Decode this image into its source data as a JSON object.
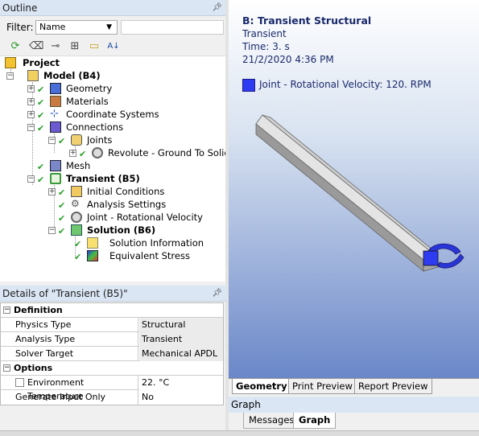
{
  "outline": {
    "title": "Outline",
    "pin": "ᵖ",
    "filter_label": "Filter:",
    "filter_value": "Name",
    "tree": [
      {
        "label": "Project"
      },
      {
        "label": "Model (B4)"
      },
      {
        "label": "Geometry"
      },
      {
        "label": "Materials"
      },
      {
        "label": "Coordinate Systems"
      },
      {
        "label": "Connections"
      },
      {
        "label": "Joints"
      },
      {
        "label": "Revolute - Ground To Solid"
      },
      {
        "label": "Mesh"
      },
      {
        "label": "Transient (B5)"
      },
      {
        "label": "Initial Conditions"
      },
      {
        "label": "Analysis Settings"
      },
      {
        "label": "Joint - Rotational Velocity"
      },
      {
        "label": "Solution (B6)"
      },
      {
        "label": "Solution Information"
      },
      {
        "label": "Equivalent Stress"
      }
    ]
  },
  "details": {
    "title": "Details of \"Transient (B5)\"",
    "sections": [
      {
        "name": "Definition",
        "rows": [
          {
            "k": "Physics Type",
            "v": "Structural"
          },
          {
            "k": "Analysis Type",
            "v": "Transient"
          },
          {
            "k": "Solver Target",
            "v": "Mechanical APDL"
          }
        ]
      },
      {
        "name": "Options",
        "rows": [
          {
            "k": "Environment Temperature",
            "v": "22. °C"
          },
          {
            "k": "Generate Input Only",
            "v": "No"
          }
        ]
      }
    ]
  },
  "viewport": {
    "title": "B: Transient Structural",
    "lines": [
      "Transient",
      "Time: 3. s",
      "21/2/2020 4:36 PM"
    ],
    "legend": "Joint - Rotational Velocity: 120. RPM",
    "legend_color": "#2f3bf0",
    "tabs": [
      "Geometry",
      "Print Preview",
      "Report Preview"
    ]
  },
  "graph": {
    "title": "Graph",
    "tabs": [
      "Messages",
      "Graph"
    ]
  }
}
